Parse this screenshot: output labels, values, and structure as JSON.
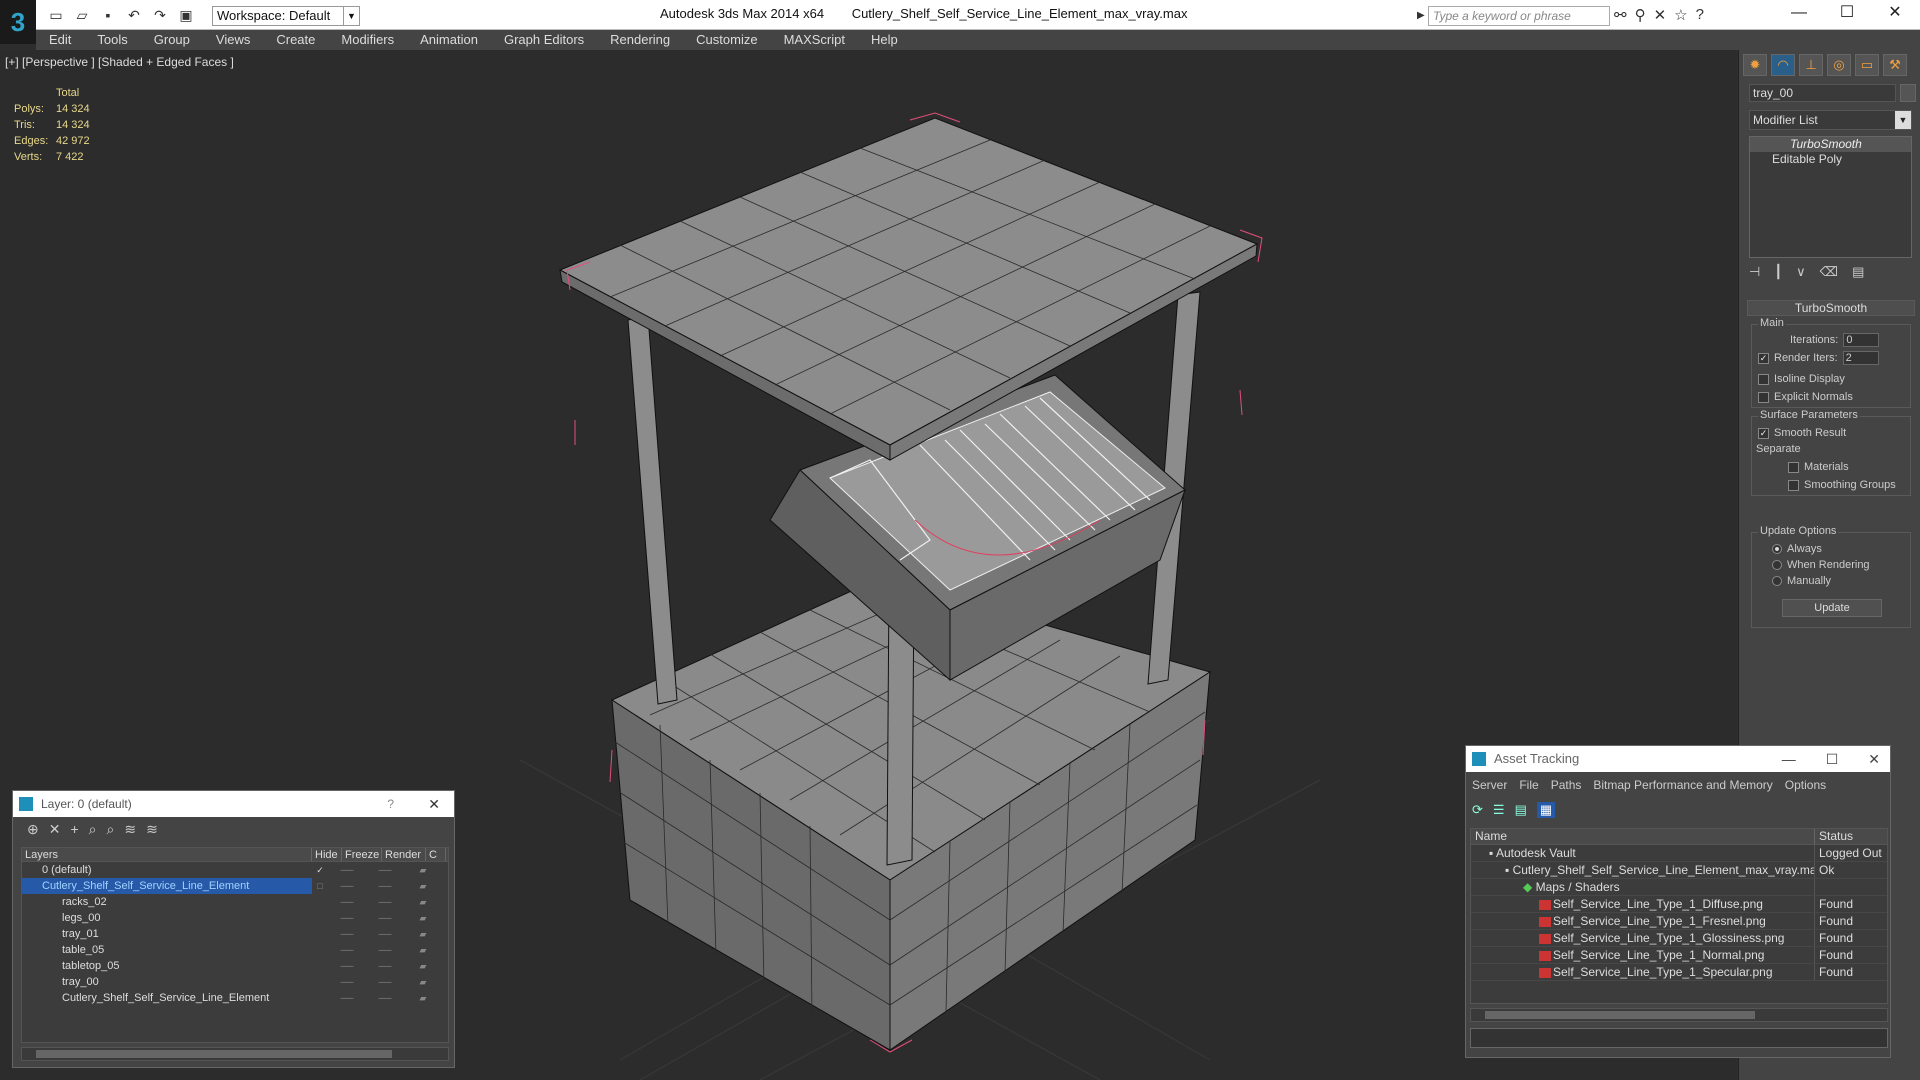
{
  "titlebar": {
    "workspace": "Workspace: Default",
    "app_name": "Autodesk 3ds Max  2014 x64",
    "file_name": "Cutlery_Shelf_Self_Service_Line_Element_max_vray.max",
    "search_placeholder": "Type a keyword or phrase"
  },
  "menu": [
    "Edit",
    "Tools",
    "Group",
    "Views",
    "Create",
    "Modifiers",
    "Animation",
    "Graph Editors",
    "Rendering",
    "Customize",
    "MAXScript",
    "Help"
  ],
  "viewport": {
    "label": "[+] [Perspective ] [Shaded + Edged Faces ]",
    "stats": {
      "header": "Total",
      "polys_label": "Polys:",
      "polys": "14 324",
      "tris_label": "Tris:",
      "tris": "14 324",
      "edges_label": "Edges:",
      "edges": "42 972",
      "verts_label": "Verts:",
      "verts": "7 422"
    }
  },
  "command_panel": {
    "object_name": "tray_00",
    "modifier_list": "Modifier List",
    "stack": [
      "TurboSmooth",
      "Editable Poly"
    ],
    "turbosmooth": {
      "title": "TurboSmooth",
      "main_group": "Main",
      "iterations_label": "Iterations:",
      "iterations": "0",
      "render_iters_label": "Render Iters:",
      "render_iters": "2",
      "isoline": "Isoline Display",
      "explicit_normals": "Explicit Normals",
      "surface_group": "Surface Parameters",
      "smooth_result": "Smooth Result",
      "separate": "Separate",
      "materials": "Materials",
      "smoothing_groups": "Smoothing Groups",
      "update_group": "Update Options",
      "always": "Always",
      "when_rendering": "When Rendering",
      "manually": "Manually",
      "update_button": "Update"
    }
  },
  "layer_dialog": {
    "title": "Layer: 0 (default)",
    "help": "?",
    "columns": [
      "Layers",
      "Hide",
      "Freeze",
      "Render",
      "C"
    ],
    "rows": [
      {
        "name": "0 (default)",
        "indent": 1
      },
      {
        "name": "Cutlery_Shelf_Self_Service_Line_Element",
        "indent": 1,
        "selected": true
      },
      {
        "name": "racks_02",
        "indent": 2
      },
      {
        "name": "legs_00",
        "indent": 2
      },
      {
        "name": "tray_01",
        "indent": 2
      },
      {
        "name": "table_05",
        "indent": 2
      },
      {
        "name": "tabletop_05",
        "indent": 2
      },
      {
        "name": "tray_00",
        "indent": 2
      },
      {
        "name": "Cutlery_Shelf_Self_Service_Line_Element",
        "indent": 2
      }
    ]
  },
  "asset_tracking": {
    "title": "Asset Tracking",
    "menu": [
      "Server",
      "File",
      "Paths",
      "Bitmap Performance and Memory",
      "Options"
    ],
    "columns": [
      "Name",
      "Status"
    ],
    "rows": [
      {
        "name": "Autodesk Vault",
        "status": "Logged Out",
        "indent": 1
      },
      {
        "name": "Cutlery_Shelf_Self_Service_Line_Element_max_vray.max",
        "status": "Ok",
        "indent": 2
      },
      {
        "name": "Maps / Shaders",
        "status": "",
        "indent": 3
      },
      {
        "name": "Self_Service_Line_Type_1_Diffuse.png",
        "status": "Found",
        "indent": 4
      },
      {
        "name": "Self_Service_Line_Type_1_Fresnel.png",
        "status": "Found",
        "indent": 4
      },
      {
        "name": "Self_Service_Line_Type_1_Glossiness.png",
        "status": "Found",
        "indent": 4
      },
      {
        "name": "Self_Service_Line_Type_1_Normal.png",
        "status": "Found",
        "indent": 4
      },
      {
        "name": "Self_Service_Line_Type_1_Specular.png",
        "status": "Found",
        "indent": 4
      }
    ]
  }
}
